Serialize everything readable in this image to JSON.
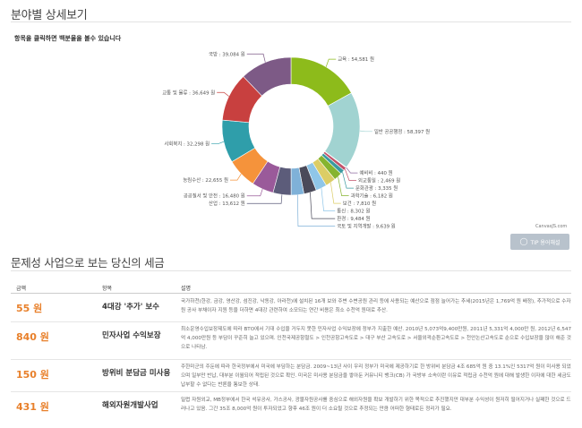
{
  "section1": {
    "title": "분야별 상세보기",
    "hint": "항목을 클릭하면 백분율을 볼수 있습니다"
  },
  "chart_data": {
    "type": "pie",
    "variant": "donut",
    "unit": "원",
    "slices": [
      {
        "label": "교육",
        "value": 54581,
        "display": "교육 : 54,581 원",
        "color": "#8dbb1b"
      },
      {
        "label": "일반공공행정",
        "value": 58397,
        "display": "일반 공공행정 : 58,397 원",
        "color": "#a1d3d1"
      },
      {
        "label": "예비비",
        "value": 440,
        "display": "예비비 : 440 원",
        "color": "#8e6aa0"
      },
      {
        "label": "외교통일",
        "value": 2469,
        "display": "외교통일 : 2,469 원",
        "color": "#c2526a"
      },
      {
        "label": "문화관광",
        "value": 3335,
        "display": "문화관광 : 3,335 원",
        "color": "#3b9aa0"
      },
      {
        "label": "과학기술",
        "value": 6182,
        "display": "과학기술 : 6,182 원",
        "color": "#86b42e"
      },
      {
        "label": "보건",
        "value": 7810,
        "display": "보건 : 7,810 원",
        "color": "#dccd66"
      },
      {
        "label": "통신",
        "value": 8302,
        "display": "통신 : 8,302 원",
        "color": "#8fc6e8"
      },
      {
        "label": "환경",
        "value": 9484,
        "display": "환경 : 9,484 원",
        "color": "#4a4a5a"
      },
      {
        "label": "국토 및 지역개발",
        "value": 9639,
        "display": "국토 및 지역개발 : 9,639 원",
        "color": "#7fb1d8"
      },
      {
        "label": "산업",
        "value": 13612,
        "display": "산업 : 13,612 원",
        "color": "#5c5c7a"
      },
      {
        "label": "공공질서 및 안전",
        "value": 16480,
        "display": "공공질서 및 안전 : 16,480 원",
        "color": "#9a5a9a"
      },
      {
        "label": "농림수산",
        "value": 22655,
        "display": "농림수산 : 22,655 원",
        "color": "#f5933b"
      },
      {
        "label": "사회복지",
        "value": 32298,
        "display": "사회복지 : 32,298 원",
        "color": "#2f9eaa"
      },
      {
        "label": "교통 및 물류",
        "value": 36649,
        "display": "교통 및 물류 : 36,649 원",
        "color": "#c8403f"
      },
      {
        "label": "국방",
        "value": 39084,
        "display": "국방 : 39,084 원",
        "color": "#7d5a86"
      }
    ]
  },
  "credit": "CanvasJS.com",
  "tip_button": {
    "label": "TIP 용어해설",
    "icon": "lightbulb-icon"
  },
  "section2": {
    "title": "문제성 사업으로 보는 당신의 세금"
  },
  "table": {
    "headers": {
      "amount": "금액",
      "item": "항목",
      "desc": "설명"
    },
    "rows": [
      {
        "amount": "55 원",
        "item": "4대강 '추가' 보수",
        "desc": "국가하천(한강, 금강, 영산강, 섬진강, 낙동강, 아라천)에 설치된 16개 보와 주변 수변공원 관리 등에 사용되는 예산으로 점점 늘어가는 추세(2015년은 1,769억 원 배정), 추가적으로 수자원 공사 부채이자 지원 등을 더하면 4대강 관련하여 소모되는 연간 비용은 최소 수천억 원대로 추산."
      },
      {
        "amount": "840 원",
        "item": "민자사업 수익보장",
        "desc": "최소운영수입보장제도에 따라 BTO에서 기대 수입을 거두지 못한 민자사업 수익보장에 정부가 지출한 예산. 2010년 5,073억9,400만원, 2011년 5,331억 4,000만 원, 2012년 6,547억 4,000만원 등 부담이 꾸준히 늘고 있으며. 인천국제공항철도 > 인천공항고속도로 > 대구 부산 고속도로 > 서울외곽순환고속도로 > 천안논산고속도로 순으로 수입보장을 많이 해준 것으로 나타남."
      },
      {
        "amount": "150 원",
        "item": "방위비 분담금 미사용",
        "desc": "주한미군의 주둔에 따라 한국정부에서 미국에 부담하는 분담금. 2009~13년 사이 우리 정부가 미국에 제공하기로 한 방위비 분담금 4조 685억 원 중 13.1%인 5317억 원이 미사용 되었으며 일부만 반납, 대부분 이월되어 적립된 것으로 확인. 미국은 미사용 분담금을 쌓아둔 커뮤니티 뱅크(CB) 가 국방부 소속이란 이유로 적립금 수천억 원에 대해 발생한 이자에 대한 세금도 납부할 수 없다는 반론을 통보한 상태."
      },
      {
        "amount": "431 원",
        "item": "해외자원개발사업",
        "desc": "밀렵 자원외교, MB정부에서 한국 석유공사, 가스공사, 광물자원공사를 중심으로 해외자원을 확보 개발하기 위한 목적으로 추진했지만 대부분 수익성이 원저히 떨어지거나 실패한 것으로 드러나고 있음. 그간 35조 8,000억 원이 투자되었고 향후 46조 원이 더 소요될 것으로 추정되는 만큼 어떠한 형태로든 정리가 필요."
      }
    ]
  }
}
